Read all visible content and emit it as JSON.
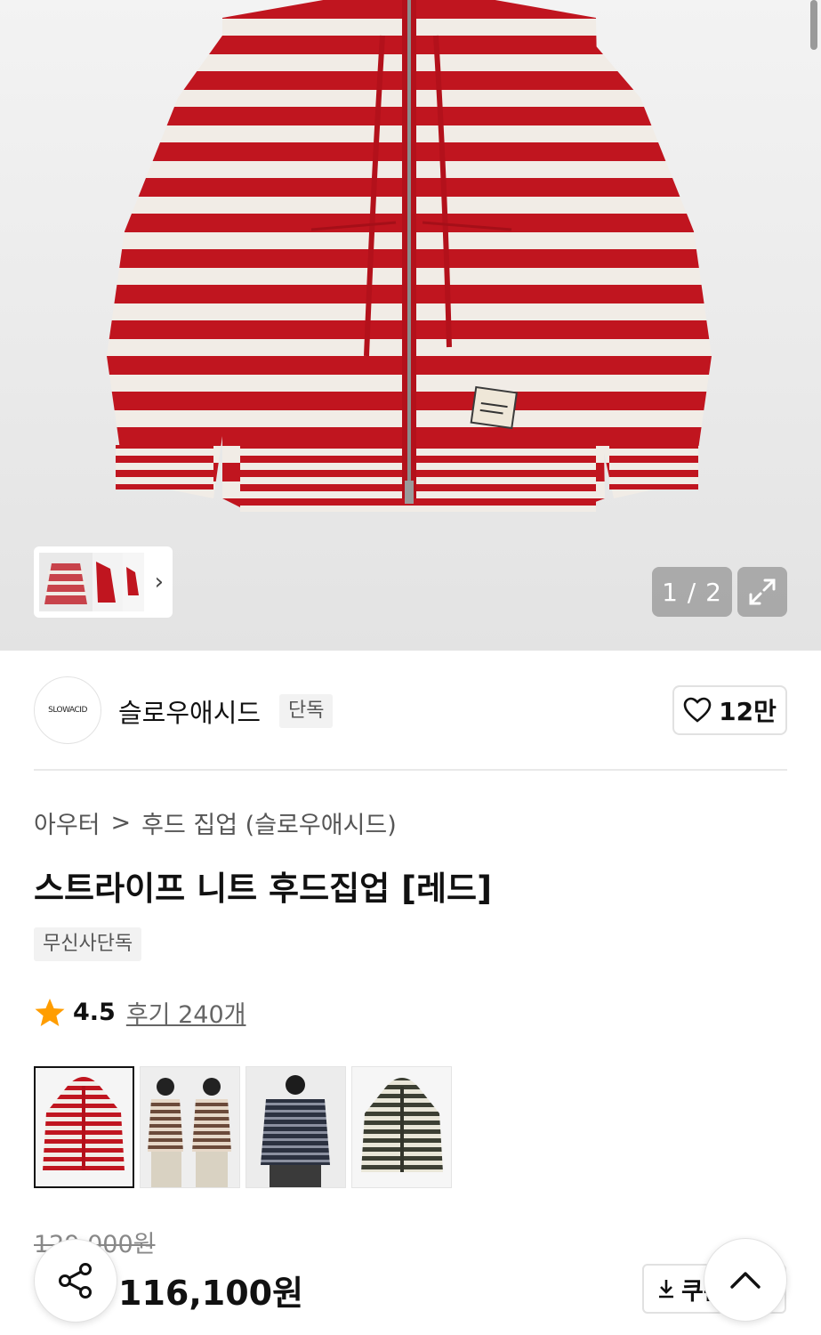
{
  "gallery": {
    "counter": "1 / 2",
    "more_label": "›"
  },
  "brand": {
    "logo_text": "SLOWACID",
    "name": "슬로우애시드",
    "badge": "단독",
    "likes": "12만"
  },
  "breadcrumb": {
    "level1": "아우터",
    "separator": ">",
    "level2": "후드 집업 (슬로우애시드)"
  },
  "product": {
    "title": "스트라이프 니트 후드집업 [레드]",
    "exclusive_tag": "무신사단독",
    "rating": "4.5",
    "reviews": "후기 240개",
    "original_price": "129,000원",
    "price": "116,100원"
  },
  "actions": {
    "coupon_label": "쿠폰"
  },
  "icons": {
    "share": "share-icon",
    "heart": "heart-icon",
    "star": "star-icon",
    "expand": "expand-icon",
    "download": "download-icon",
    "scroll_top": "chevron-up-icon"
  },
  "colors": {
    "stripe_red": "#c0151f",
    "stripe_cream": "#f1ece6",
    "star": "#ff9d00"
  }
}
